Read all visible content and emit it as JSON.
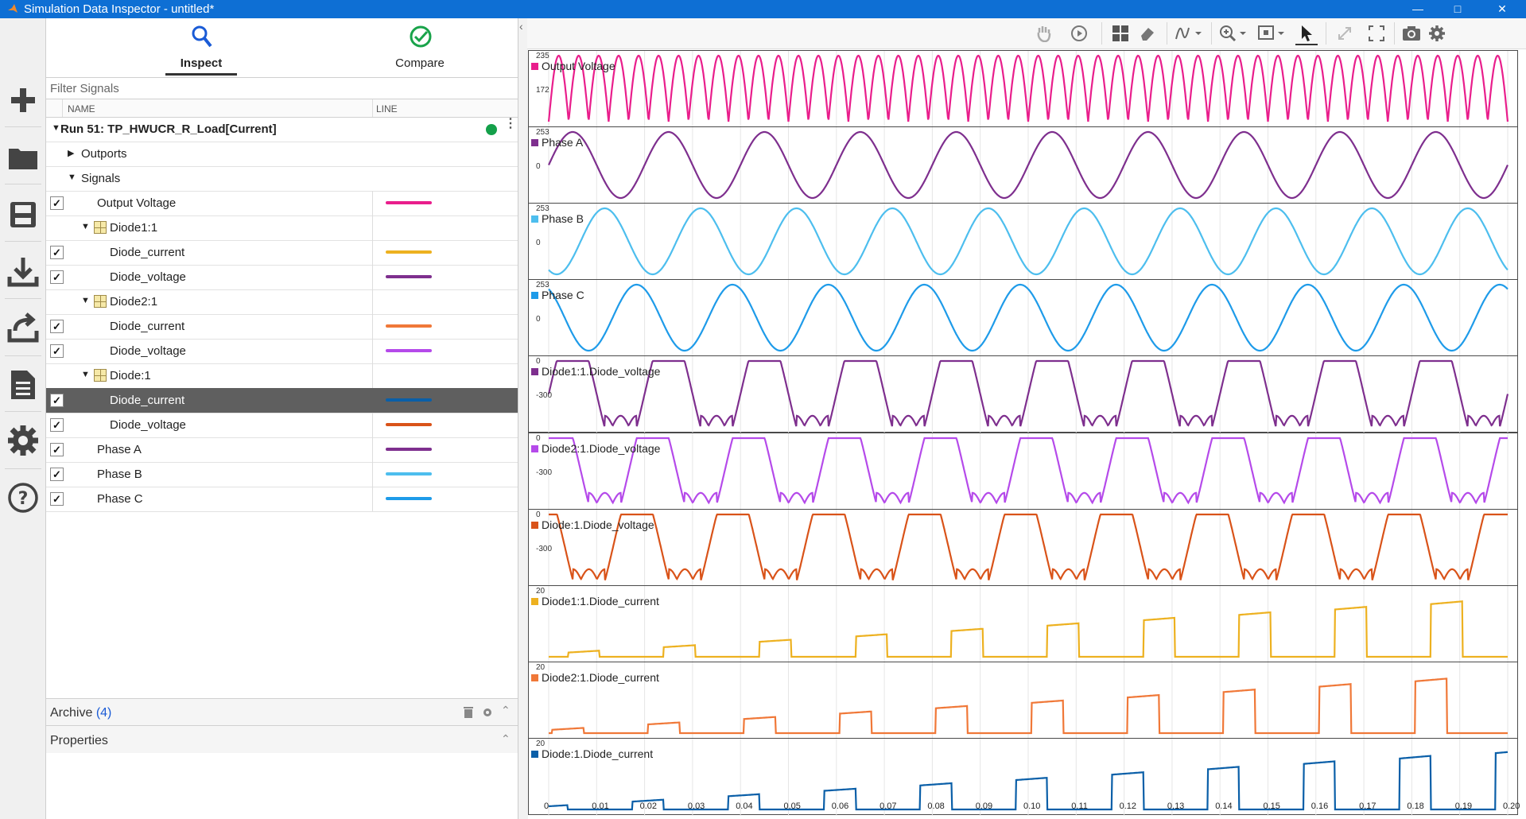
{
  "window": {
    "title": "Simulation Data Inspector - untitled*"
  },
  "sidebar": {
    "buttons": [
      {
        "name": "new-button",
        "icon": "plus-icon"
      },
      {
        "name": "open-button",
        "icon": "folder-icon"
      },
      {
        "name": "save-button",
        "icon": "save-icon"
      },
      {
        "name": "import-button",
        "icon": "download-icon"
      },
      {
        "name": "export-button",
        "icon": "share-icon"
      },
      {
        "name": "report-button",
        "icon": "document-icon"
      },
      {
        "name": "settings-button",
        "icon": "gear-icon"
      },
      {
        "name": "help-button",
        "icon": "help-icon"
      }
    ]
  },
  "tabs": {
    "inspect": "Inspect",
    "compare": "Compare"
  },
  "filter": {
    "placeholder": "Filter Signals"
  },
  "columns": {
    "name": "NAME",
    "line": "LINE"
  },
  "tree": {
    "run": "Run 51: TP_HWUCR_R_Load[Current]",
    "outports": "Outports",
    "signals": "Signals",
    "rows": [
      {
        "label": "Output Voltage",
        "color": "#e91e8c",
        "checked": true
      },
      {
        "label": "Diode1:1",
        "group": true
      },
      {
        "label": "Diode_current",
        "color": "#edb120",
        "checked": true
      },
      {
        "label": "Diode_voltage",
        "color": "#7e2f8e",
        "checked": true
      },
      {
        "label": "Diode2:1",
        "group": true
      },
      {
        "label": "Diode_current",
        "color": "#f07838",
        "checked": true
      },
      {
        "label": "Diode_voltage",
        "color": "#b54aea",
        "checked": true
      },
      {
        "label": "Diode:1",
        "group": true
      },
      {
        "label": "Diode_current",
        "color": "#0a5fa8",
        "checked": true,
        "selected": true
      },
      {
        "label": "Diode_voltage",
        "color": "#d95319",
        "checked": true
      },
      {
        "label": "Phase A",
        "color": "#7e2f8e",
        "checked": true
      },
      {
        "label": "Phase B",
        "color": "#4dbeee",
        "checked": true
      },
      {
        "label": "Phase C",
        "color": "#1e9be9",
        "checked": true
      }
    ]
  },
  "archive": {
    "label": "Archive",
    "count": "(4)"
  },
  "properties": {
    "label": "Properties"
  },
  "chart_data": {
    "type": "line",
    "x_ticks": [
      "0",
      "0.01",
      "0.02",
      "0.03",
      "0.04",
      "0.05",
      "0.06",
      "0.07",
      "0.08",
      "0.09",
      "0.10",
      "0.11",
      "0.12",
      "0.13",
      "0.14",
      "0.15",
      "0.16",
      "0.17",
      "0.18",
      "0.19",
      "0.20"
    ],
    "xlim": [
      0,
      0.2
    ],
    "grid": true,
    "subplots": [
      {
        "name": "Output Voltage",
        "color": "#e91e8c",
        "kind": "rectified",
        "ticks": [
          "235",
          "172"
        ],
        "amplitude": 253,
        "frequency": 100
      },
      {
        "name": "Phase A",
        "color": "#7e2f8e",
        "kind": "sine",
        "ticks": [
          "253",
          "0"
        ],
        "amplitude": 253,
        "frequency": 50,
        "phase_deg": 0
      },
      {
        "name": "Phase B",
        "color": "#4dbeee",
        "kind": "sine",
        "ticks": [
          "253",
          "0"
        ],
        "amplitude": 253,
        "frequency": 50,
        "phase_deg": -120
      },
      {
        "name": "Phase C",
        "color": "#1e9be9",
        "kind": "sine",
        "ticks": [
          "253",
          "0"
        ],
        "amplitude": 253,
        "frequency": 50,
        "phase_deg": 120
      },
      {
        "name": "Diode1:1.Diode_voltage",
        "color": "#7e2f8e",
        "kind": "diodev",
        "ticks": [
          "0",
          "-300"
        ],
        "range": [
          -440,
          0
        ]
      },
      {
        "name": "Diode2:1.Diode_voltage",
        "color": "#b54aea",
        "kind": "diodev",
        "ticks": [
          "0",
          "-300"
        ],
        "range": [
          -440,
          0
        ]
      },
      {
        "name": "Diode:1.Diode_voltage",
        "color": "#d95319",
        "kind": "diodev",
        "ticks": [
          "0",
          "-300"
        ],
        "range": [
          -440,
          0
        ]
      },
      {
        "name": "Diode1:1.Diode_current",
        "color": "#edb120",
        "kind": "diodei",
        "ticks": [
          "20"
        ],
        "peak_start": 1.5,
        "peak_end": 27
      },
      {
        "name": "Diode2:1.Diode_current",
        "color": "#f07838",
        "kind": "diodei",
        "ticks": [
          "20"
        ],
        "peak_start": 1.5,
        "peak_end": 27
      },
      {
        "name": "Diode:1.Diode_current",
        "color": "#0a5fa8",
        "kind": "diodei",
        "ticks": [
          "20"
        ],
        "peak_start": 1.5,
        "peak_end": 27
      }
    ]
  }
}
